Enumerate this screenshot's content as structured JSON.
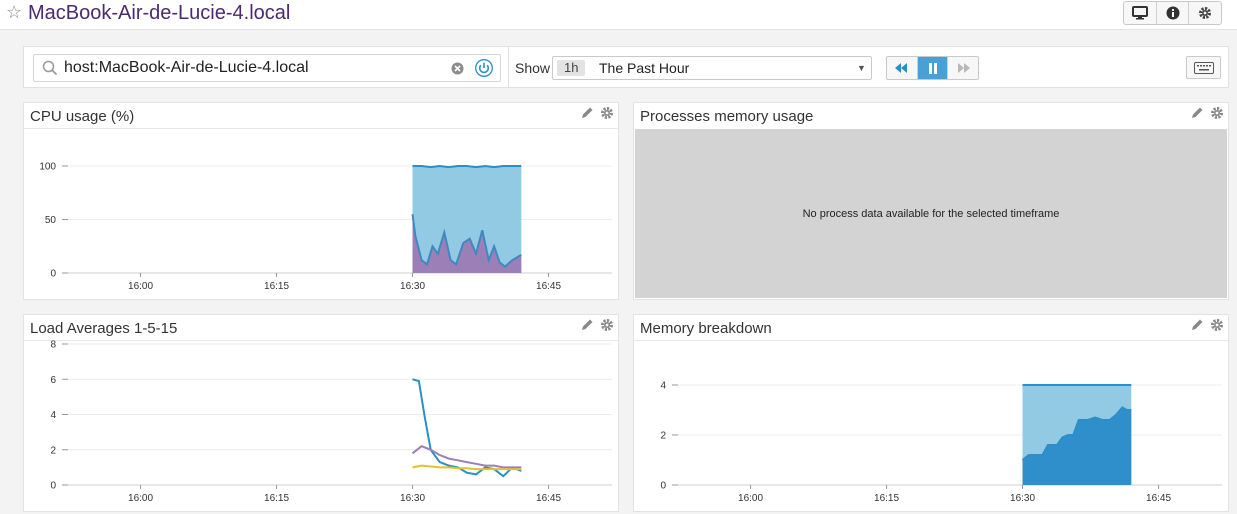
{
  "header": {
    "title": "MacBook-Air-de-Lucie-4.local",
    "icons": [
      "star-icon",
      "monitor-icon",
      "info-icon",
      "gear-icon"
    ]
  },
  "search": {
    "value": "host:MacBook-Air-de-Lucie-4.local",
    "icons": [
      "search-icon",
      "clear-icon",
      "power-icon"
    ]
  },
  "timeframe": {
    "show_label": "Show",
    "badge": "1h",
    "selected": "The Past Hour"
  },
  "colors": {
    "title": "#4b2a70",
    "blue": "#2b8fc7",
    "light_blue": "#92c9e3",
    "purple": "#9b7fb6",
    "yellow": "#e1c22a",
    "nodata_bg": "#d3d3d3"
  },
  "widgets": {
    "cpu": {
      "title": "CPU usage (%)"
    },
    "procmem": {
      "title": "Processes memory usage",
      "empty_message": "No process data available for the selected timeframe"
    },
    "load": {
      "title": "Load Averages 1-5-15"
    },
    "mem": {
      "title": "Memory breakdown"
    }
  },
  "chart_data": [
    {
      "id": "cpu",
      "type": "area",
      "title": "CPU usage (%)",
      "x_ticks": [
        "16:00",
        "16:15",
        "16:30",
        "16:45"
      ],
      "y_ticks": [
        "0",
        "50",
        "100"
      ],
      "ylim": [
        0,
        100
      ],
      "x_range_minutes": [
        0,
        60
      ],
      "x_tick_minutes": [
        8,
        23,
        38,
        53
      ],
      "series": [
        {
          "color": "#92c9e3",
          "stroke": "#2b8fc7",
          "x": [
            38,
            39,
            40,
            41,
            42,
            43,
            44,
            45,
            46,
            47,
            48,
            49,
            50
          ],
          "values": [
            100,
            100,
            99,
            100,
            99,
            100,
            100,
            99,
            100,
            99,
            100,
            100,
            100
          ]
        },
        {
          "color": "#9b7fb6",
          "stroke": "#3f88c0",
          "x": [
            38,
            38.3,
            39,
            39.6,
            40.2,
            40.8,
            41.5,
            42.2,
            42.8,
            43.6,
            44.3,
            45,
            45.7,
            46.4,
            47,
            47.6,
            48.2,
            49,
            50
          ],
          "values": [
            55,
            35,
            12,
            8,
            25,
            18,
            38,
            12,
            8,
            28,
            32,
            18,
            40,
            12,
            25,
            10,
            6,
            12,
            17
          ]
        }
      ]
    },
    {
      "id": "load",
      "type": "line",
      "title": "Load Averages 1-5-15",
      "x_ticks": [
        "16:00",
        "16:15",
        "16:30",
        "16:45"
      ],
      "y_ticks": [
        "0",
        "2",
        "4",
        "6",
        "8"
      ],
      "ylim": [
        0,
        8
      ],
      "x_range_minutes": [
        0,
        60
      ],
      "x_tick_minutes": [
        8,
        23,
        38,
        53
      ],
      "series": [
        {
          "color": "#2b8fc7",
          "x": [
            38,
            38.7,
            39.3,
            40,
            41,
            42,
            43,
            44,
            45,
            46,
            47,
            48,
            49,
            50
          ],
          "values": [
            6.0,
            5.9,
            4.0,
            2.0,
            1.3,
            1.1,
            1.0,
            0.7,
            0.6,
            1.0,
            0.9,
            0.5,
            1.0,
            0.8
          ]
        },
        {
          "color": "#9b7fb6",
          "x": [
            38,
            39,
            40,
            41,
            42,
            43,
            44,
            45,
            46,
            47,
            48,
            49,
            50
          ],
          "values": [
            1.8,
            2.2,
            2.0,
            1.7,
            1.5,
            1.4,
            1.3,
            1.2,
            1.1,
            1.1,
            1.0,
            1.0,
            1.0
          ]
        },
        {
          "color": "#e1c22a",
          "x": [
            38,
            39,
            40,
            41,
            42,
            43,
            44,
            45,
            46,
            47,
            48,
            49,
            50
          ],
          "values": [
            1.0,
            1.1,
            1.05,
            1.0,
            1.0,
            0.95,
            0.95,
            0.9,
            0.9,
            0.9,
            0.9,
            0.9,
            0.9
          ]
        }
      ]
    },
    {
      "id": "mem",
      "type": "area",
      "title": "Memory breakdown",
      "x_ticks": [
        "16:00",
        "16:15",
        "16:30",
        "16:45"
      ],
      "y_ticks": [
        "0",
        "2",
        "4"
      ],
      "ylim": [
        0,
        4
      ],
      "x_range_minutes": [
        0,
        60
      ],
      "x_tick_minutes": [
        8,
        23,
        38,
        53
      ],
      "series": [
        {
          "color": "#92c9e3",
          "stroke": "#2b8fc7",
          "x": [
            38,
            50
          ],
          "values": [
            4.0,
            4.0
          ]
        },
        {
          "color": "#2f8fcb",
          "stroke": "#2b8fc7",
          "x": [
            38,
            38.7,
            39.2,
            40.2,
            40.8,
            41.8,
            42.4,
            43,
            43.6,
            44.2,
            45.2,
            46,
            46.8,
            47.6,
            48.3,
            49,
            49.5,
            50
          ],
          "values": [
            1.0,
            1.2,
            1.2,
            1.2,
            1.6,
            1.6,
            1.9,
            2.0,
            2.0,
            2.6,
            2.6,
            2.7,
            2.6,
            2.6,
            2.8,
            3.1,
            3.0,
            3.0
          ]
        }
      ]
    }
  ]
}
